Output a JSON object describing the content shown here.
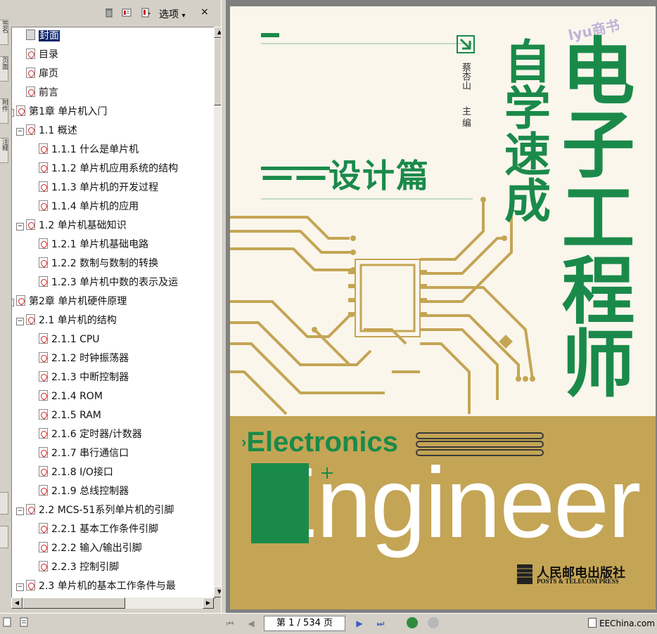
{
  "left_strip": {
    "tabs": [
      "签名",
      "页面",
      "附件",
      "注释"
    ]
  },
  "bookmarks_panel": {
    "options_label": "选项",
    "options_caret": "▾",
    "close_glyph": "×",
    "icons": [
      "delete-bookmark-icon",
      "expand-bookmark-icon",
      "bookmark-options-icon"
    ],
    "items": [
      {
        "label": "封面",
        "level": 0,
        "toggle": "",
        "selected": true
      },
      {
        "label": "目录",
        "level": 0,
        "toggle": ""
      },
      {
        "label": "扉页",
        "level": 0,
        "toggle": ""
      },
      {
        "label": "前言",
        "level": 0,
        "toggle": ""
      },
      {
        "label": "第1章 单片机入门",
        "level": 0,
        "toggle": "−"
      },
      {
        "label": "1.1 概述",
        "level": 1,
        "toggle": "−"
      },
      {
        "label": "1.1.1 什么是单片机",
        "level": 2,
        "toggle": ""
      },
      {
        "label": "1.1.2 单片机应用系统的结构",
        "level": 2,
        "toggle": ""
      },
      {
        "label": "1.1.3 单片机的开发过程",
        "level": 2,
        "toggle": ""
      },
      {
        "label": "1.1.4 单片机的应用",
        "level": 2,
        "toggle": ""
      },
      {
        "label": "1.2 单片机基础知识",
        "level": 1,
        "toggle": "−"
      },
      {
        "label": "1.2.1 单片机基础电路",
        "level": 2,
        "toggle": ""
      },
      {
        "label": "1.2.2 数制与数制的转换",
        "level": 2,
        "toggle": ""
      },
      {
        "label": "1.2.3 单片机中数的表示及运",
        "level": 2,
        "toggle": ""
      },
      {
        "label": "第2章 单片机硬件原理",
        "level": 0,
        "toggle": "−"
      },
      {
        "label": "2.1 单片机的结构",
        "level": 1,
        "toggle": "−"
      },
      {
        "label": "2.1.1 CPU",
        "level": 2,
        "toggle": ""
      },
      {
        "label": "2.1.2 时钟振荡器",
        "level": 2,
        "toggle": ""
      },
      {
        "label": "2.1.3 中断控制器",
        "level": 2,
        "toggle": ""
      },
      {
        "label": "2.1.4 ROM",
        "level": 2,
        "toggle": ""
      },
      {
        "label": "2.1.5 RAM",
        "level": 2,
        "toggle": ""
      },
      {
        "label": "2.1.6 定时器/计数器",
        "level": 2,
        "toggle": ""
      },
      {
        "label": "2.1.7 串行通信口",
        "level": 2,
        "toggle": ""
      },
      {
        "label": "2.1.8 I/O接口",
        "level": 2,
        "toggle": ""
      },
      {
        "label": "2.1.9 总线控制器",
        "level": 2,
        "toggle": ""
      },
      {
        "label": "2.2 MCS-51系列单片机的引脚",
        "level": 1,
        "toggle": "−"
      },
      {
        "label": "2.2.1 基本工作条件引脚",
        "level": 2,
        "toggle": ""
      },
      {
        "label": "2.2.2 输入/输出引脚",
        "level": 2,
        "toggle": ""
      },
      {
        "label": "2.2.3 控制引脚",
        "level": 2,
        "toggle": ""
      },
      {
        "label": "2.3 单片机的基本工作条件与最",
        "level": 1,
        "toggle": "−"
      }
    ]
  },
  "cover": {
    "title_main": "电子工程师",
    "title_sub": "自学速成",
    "series": "——设计篇",
    "author": "蔡杏山",
    "author_role": "主编",
    "watermark_stamp": "lyu商书",
    "english_line1": "Electronics",
    "english_line2": "Engineer",
    "publisher_cn": "人民邮电出版社",
    "publisher_en": "POSTS & TELECOM PRESS",
    "colors": {
      "green": "#1a8a4a",
      "gold": "#c4a555",
      "paper": "#faf6ec"
    }
  },
  "statusbar": {
    "page_display": "第 1 / 534 页",
    "watermark": "EEChina.com"
  }
}
